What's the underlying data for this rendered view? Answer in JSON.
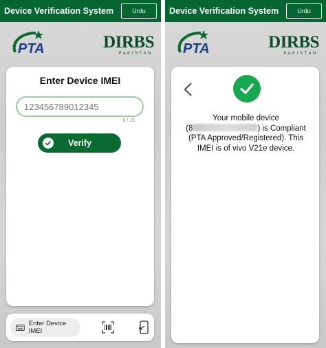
{
  "app": {
    "title": "Device Verification System",
    "language_button": "Urdu",
    "brand_color": "#056631"
  },
  "logos": {
    "pta": "PTA",
    "dirbs": "DIRBS",
    "dirbs_sub": "PAKISTAN"
  },
  "entry_screen": {
    "card_title": "Enter Device IMEI",
    "imei_placeholder": "123456789012345",
    "imei_value": "",
    "char_counter": "0 / 15",
    "verify_label": "Verify",
    "verify_icon": "check-circle-icon"
  },
  "bottom_nav": {
    "imei_tab_label": "Enter Device IMEI",
    "imei_tab_icon": "keyboard-icon",
    "scan_icon": "barcode-scan-icon",
    "export_icon": "export-icon"
  },
  "result_screen": {
    "status_icon": "check-circle-icon",
    "status_color": "#18a84f",
    "line1": "Your mobile device",
    "imei_prefix": "(8",
    "imei_suffix": ") is Compliant",
    "line3": "(PTA Approved/Registered). This",
    "line4": "IMEI is of vivo V21e device."
  }
}
